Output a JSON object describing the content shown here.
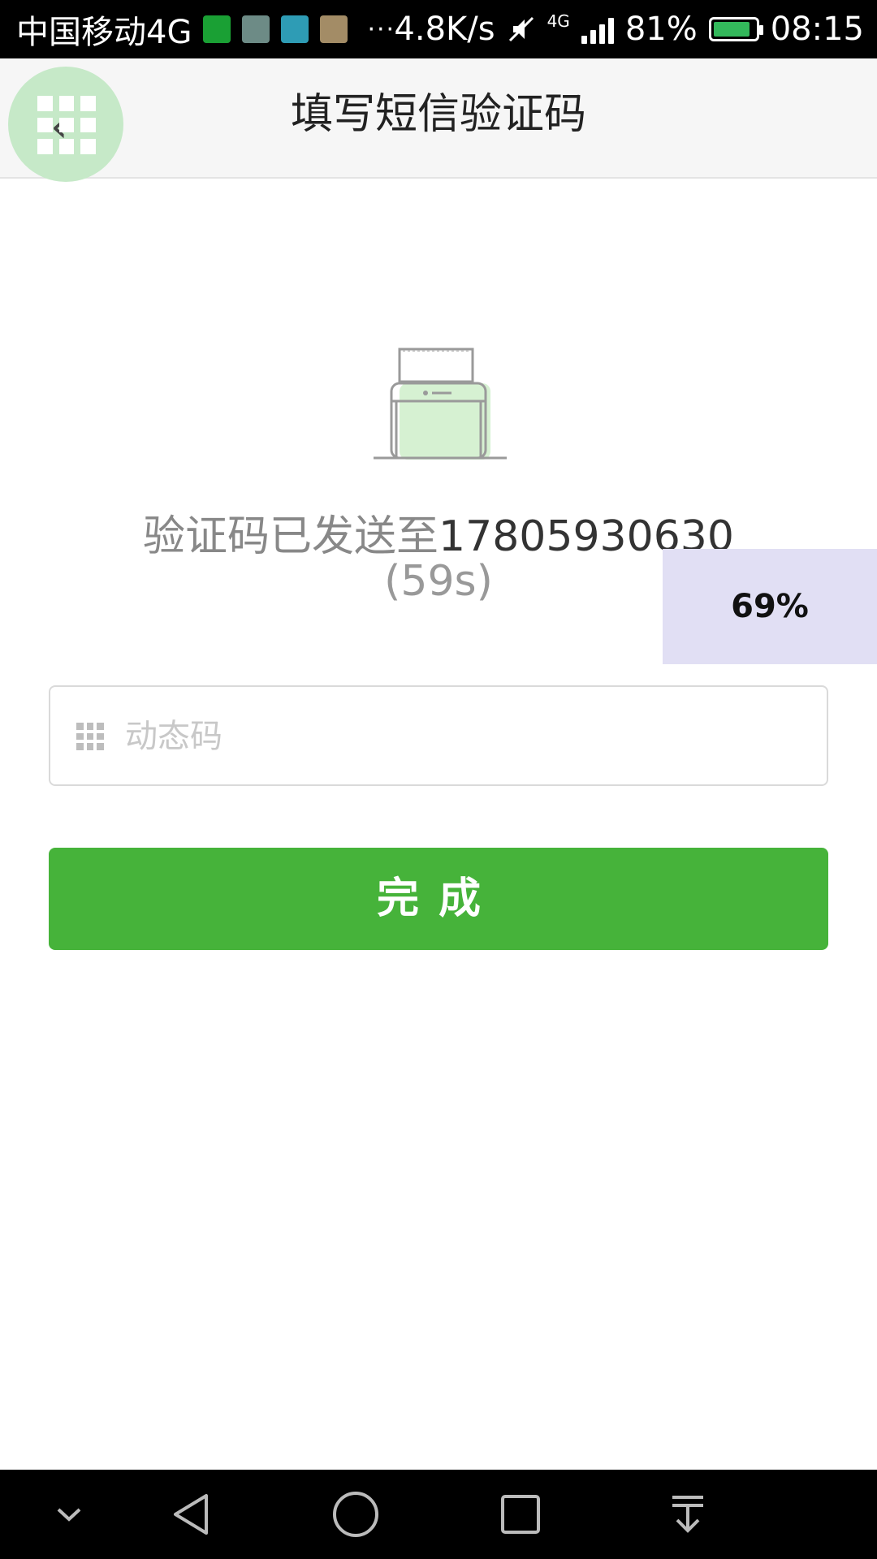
{
  "status_bar": {
    "carrier": "中国移动4G",
    "speed": "4.8K/s",
    "network": "4G",
    "battery": "81%",
    "time": "08:15",
    "more": "···"
  },
  "header": {
    "title": "填写短信验证码"
  },
  "message": {
    "prefix": "验证码已发送至",
    "phone": "17805930630",
    "countdown": "(59s)"
  },
  "progress_badge": "69%",
  "input": {
    "placeholder": "动态码",
    "value": ""
  },
  "button": {
    "label": "完成"
  },
  "colors": {
    "primary": "#46b33a",
    "float_button": "#c6e9c8",
    "progress_badge_bg": "#e1dff4"
  },
  "nav_icons": [
    "chevron-down-icon",
    "back-triangle-icon",
    "home-circle-icon",
    "recents-square-icon",
    "notification-pull-icon"
  ]
}
